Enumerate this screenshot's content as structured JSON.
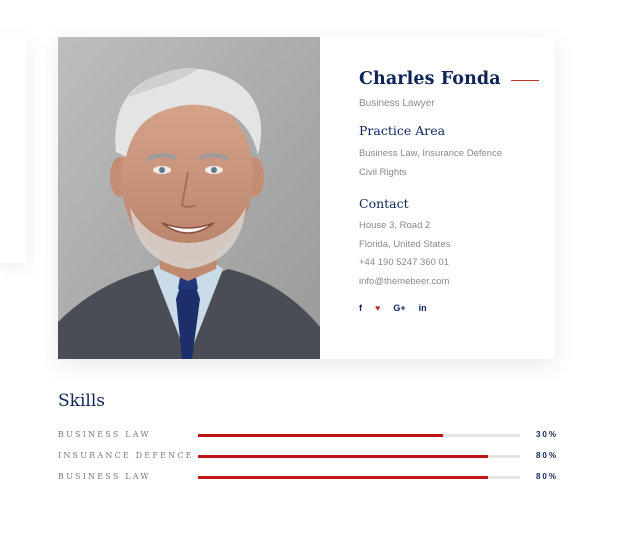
{
  "profile": {
    "name": "Charles Fonda",
    "role": "Business Lawyer",
    "practice_title": "Practice Area",
    "practice_lines": [
      "Business Law, Insurance Defence",
      "Civil Rights"
    ],
    "contact_title": "Contact",
    "contact_lines": [
      "House 3, Road 2",
      "Florida, United States",
      "+44 190 5247 360 01",
      "info@themebeer.com"
    ],
    "social": [
      {
        "icon": "facebook-icon",
        "glyph": "f"
      },
      {
        "icon": "twitter-icon",
        "glyph": "♥"
      },
      {
        "icon": "google-plus-icon",
        "glyph": "G+"
      },
      {
        "icon": "linkedin-icon",
        "glyph": "in"
      }
    ]
  },
  "skills": {
    "title": "Skills",
    "items": [
      {
        "label": "BUSINESS LAW",
        "percent_label": "30%",
        "fill": 0.76
      },
      {
        "label": "INSURANCE DEFENCE",
        "percent_label": "80%",
        "fill": 0.9
      },
      {
        "label": "BUSINESS LAW",
        "percent_label": "80%",
        "fill": 0.9
      }
    ]
  },
  "colors": {
    "navy": "#0f2557",
    "accent": "#c0161b",
    "muted": "#8a8a8a"
  }
}
